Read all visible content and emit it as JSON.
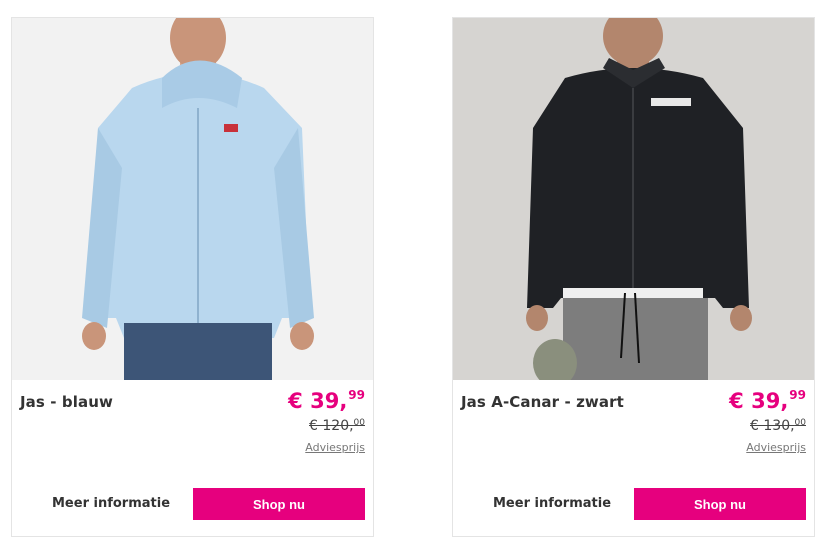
{
  "products": [
    {
      "title": "Jas - blauw",
      "price_whole": "€ 39,",
      "price_cents": "99",
      "old_price_whole": "€ 120,",
      "old_price_cents": "00",
      "advice_label": "Adviesprijs",
      "more_label": "Meer informatie",
      "shop_label": "Shop nu",
      "image_icon": "product-photo-blue-jacket"
    },
    {
      "title": "Jas A-Canar - zwart",
      "price_whole": "€ 39,",
      "price_cents": "99",
      "old_price_whole": "€ 130,",
      "old_price_cents": "00",
      "advice_label": "Adviesprijs",
      "more_label": "Meer informatie",
      "shop_label": "Shop nu",
      "image_icon": "product-photo-black-jacket"
    }
  ],
  "colors": {
    "accent": "#e6007e",
    "card_border": "#e4e4e4"
  }
}
